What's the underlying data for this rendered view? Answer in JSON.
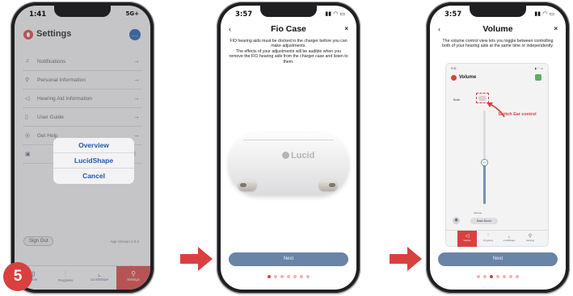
{
  "step_badge": "5",
  "phone1": {
    "status_time": "1:41",
    "status_icons": "5G+",
    "title": "Settings",
    "help_icon": "chat-bubble-icon",
    "menu": [
      {
        "label": "Notifications",
        "icon": "bell-icon"
      },
      {
        "label": "Personal Information",
        "icon": "person-icon"
      },
      {
        "label": "Hearing Aid Information",
        "icon": "hearing-aid-icon"
      },
      {
        "label": "User Guide",
        "icon": "book-icon"
      },
      {
        "label": "Get Help",
        "icon": "help-icon"
      },
      {
        "label": "",
        "icon": "settings-square-icon"
      }
    ],
    "action_sheet": [
      "Overview",
      "LucidShape",
      "Cancel"
    ],
    "sign_out": "Sign Out",
    "version": "App Version 2.0.0",
    "tabs": [
      {
        "label": "Volume",
        "icon": "speaker-icon"
      },
      {
        "label": "Programs",
        "icon": "equalizer-icon"
      },
      {
        "label": "LucidShape",
        "icon": "chart-icon"
      },
      {
        "label": "Settings",
        "icon": "person-icon"
      }
    ]
  },
  "phone2": {
    "status_time": "3:57",
    "title": "Fio Case",
    "close": "×",
    "back": "‹",
    "description_1": "FIO hearing aids must be docked in the charger before you can make adjustments.",
    "description_2": "The effects of your adjustments will be audible when you remove the FIO hearing aids from the charger case and listen to them.",
    "case_brand": "Lucid",
    "next": "Next",
    "active_dot": 1
  },
  "phone3": {
    "status_time": "3:57",
    "title": "Volume",
    "close": "×",
    "back": "‹",
    "description": "The volume control view lets you toggle between controlling both of your hearing aids at the same time or independently.",
    "inner_status_time": "9:41",
    "inner_title": "Volume",
    "both_label": "Both",
    "callout": "Switch Ear control",
    "slider_value": "0",
    "slider_level": 0.55,
    "footer_label": "Volume",
    "footer_button": "Bass Boost",
    "tabs": [
      "Volume",
      "Programs",
      "LucidShape",
      "Settings"
    ],
    "next": "Next",
    "active_dot": 3
  },
  "colors": {
    "accent": "#d8413f",
    "primary_blue": "#1e5aa8",
    "button_slate": "#6a84a6"
  }
}
